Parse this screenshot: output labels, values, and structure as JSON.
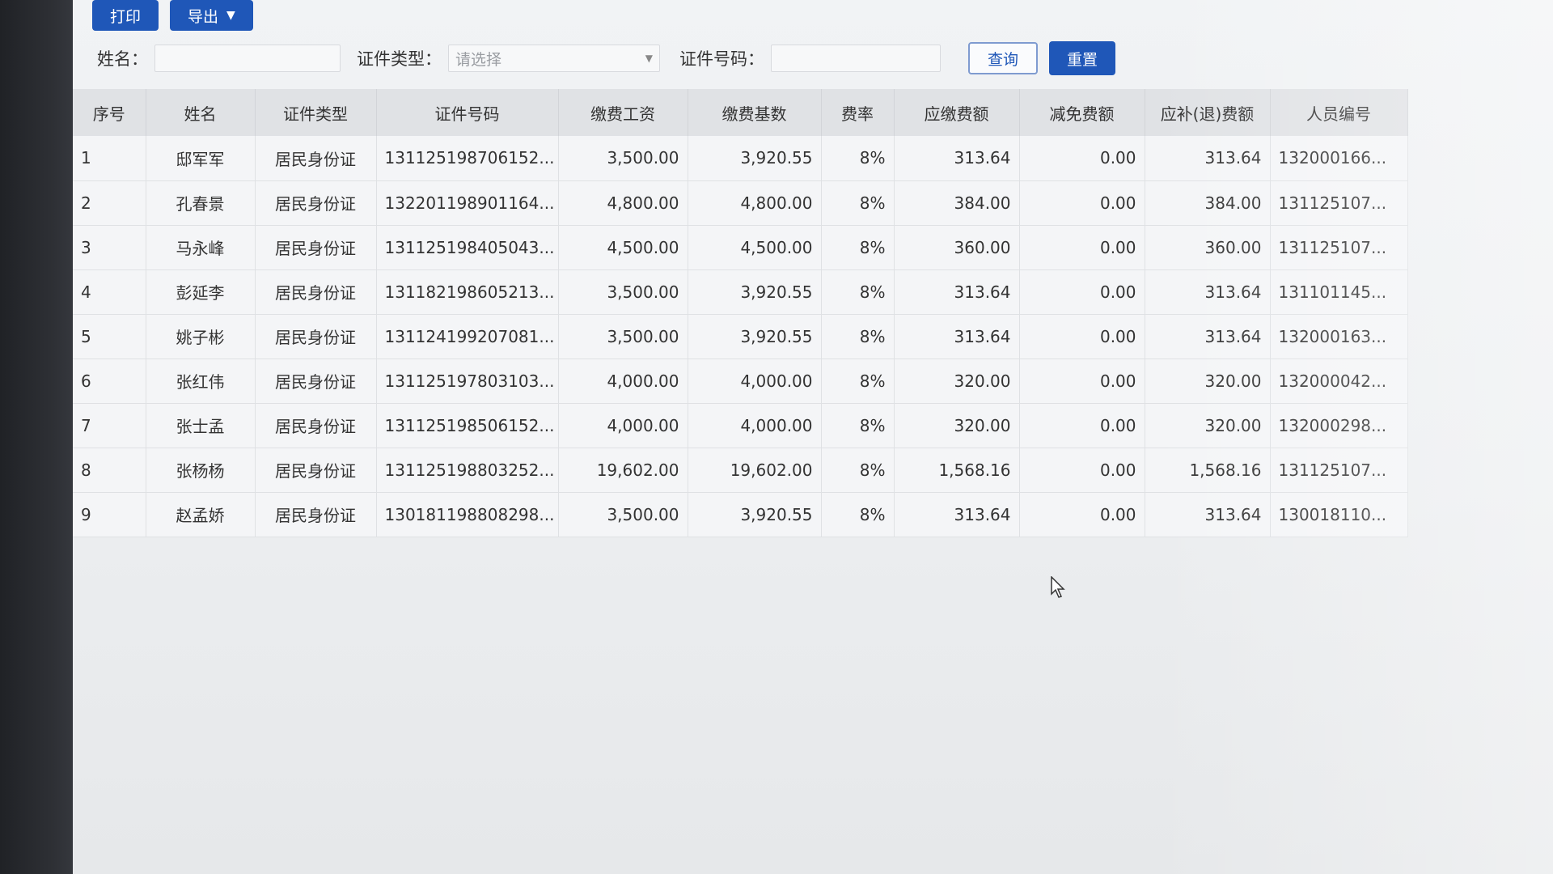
{
  "toolbar": {
    "print_label": "打印",
    "export_label": "导出"
  },
  "search": {
    "name_label": "姓名：",
    "name_value": "",
    "id_type_label": "证件类型：",
    "id_type_placeholder": "请选择",
    "id_number_label": "证件号码：",
    "id_number_value": "",
    "query_label": "查询",
    "reset_label": "重置"
  },
  "table": {
    "headers": [
      "序号",
      "姓名",
      "证件类型",
      "证件号码",
      "缴费工资",
      "缴费基数",
      "费率",
      "应缴费额",
      "减免费额",
      "应补(退)费额",
      "人员编号"
    ],
    "rows": [
      [
        "1",
        "邸军军",
        "居民身份证",
        "131125198706152...",
        "3,500.00",
        "3,920.55",
        "8%",
        "313.64",
        "0.00",
        "313.64",
        "132000166..."
      ],
      [
        "2",
        "孔春景",
        "居民身份证",
        "132201198901164...",
        "4,800.00",
        "4,800.00",
        "8%",
        "384.00",
        "0.00",
        "384.00",
        "131125107..."
      ],
      [
        "3",
        "马永峰",
        "居民身份证",
        "131125198405043...",
        "4,500.00",
        "4,500.00",
        "8%",
        "360.00",
        "0.00",
        "360.00",
        "131125107..."
      ],
      [
        "4",
        "彭延李",
        "居民身份证",
        "131182198605213...",
        "3,500.00",
        "3,920.55",
        "8%",
        "313.64",
        "0.00",
        "313.64",
        "131101145..."
      ],
      [
        "5",
        "姚子彬",
        "居民身份证",
        "131124199207081...",
        "3,500.00",
        "3,920.55",
        "8%",
        "313.64",
        "0.00",
        "313.64",
        "132000163..."
      ],
      [
        "6",
        "张红伟",
        "居民身份证",
        "131125197803103...",
        "4,000.00",
        "4,000.00",
        "8%",
        "320.00",
        "0.00",
        "320.00",
        "132000042..."
      ],
      [
        "7",
        "张士孟",
        "居民身份证",
        "131125198506152...",
        "4,000.00",
        "4,000.00",
        "8%",
        "320.00",
        "0.00",
        "320.00",
        "132000298..."
      ],
      [
        "8",
        "张杨杨",
        "居民身份证",
        "131125198803252...",
        "19,602.00",
        "19,602.00",
        "8%",
        "1,568.16",
        "0.00",
        "1,568.16",
        "131125107..."
      ],
      [
        "9",
        "赵孟娇",
        "居民身份证",
        "130181198808298...",
        "3,500.00",
        "3,920.55",
        "8%",
        "313.64",
        "0.00",
        "313.64",
        "130018110..."
      ]
    ]
  },
  "icons": {
    "dropdown": "chevron-down-icon",
    "cursor": "mouse-pointer-icon"
  },
  "colors": {
    "primary": "#1f57b8",
    "header_bg": "#e0e2e5"
  }
}
